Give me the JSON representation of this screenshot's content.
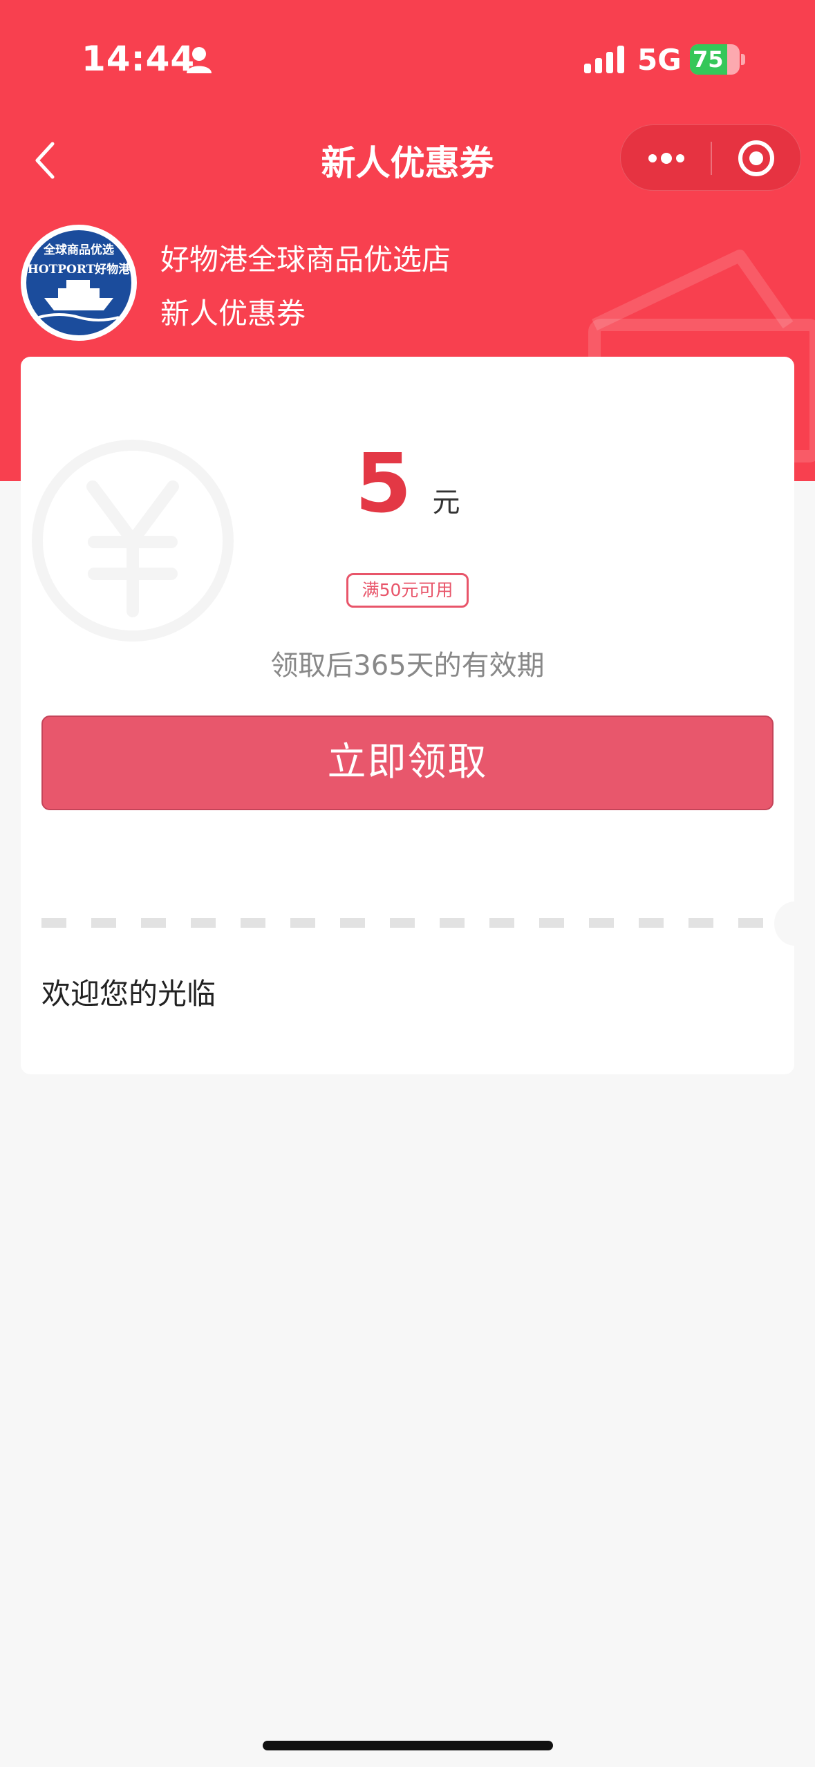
{
  "status_bar": {
    "time": "14:44",
    "network": "5G",
    "battery": "75",
    "battery_level": 0.75
  },
  "nav": {
    "title": "新人优惠券"
  },
  "shop": {
    "name": "好物港全球商品优选店",
    "subtitle": "新人优惠券",
    "logo_text_top": "全球商品优选",
    "logo_text_main": "HOTPORT好物港"
  },
  "coupon": {
    "amount": "5",
    "unit": "元",
    "condition": "满50元可用",
    "validity": "领取后365天的有效期",
    "claim_label": "立即领取",
    "welcome": "欢迎您的光临"
  },
  "colors": {
    "brand_red": "#f8404f",
    "amount_red": "#e33845",
    "button_pink": "#e8576c",
    "battery_green": "#35c759"
  },
  "icons": [
    "person-icon",
    "signal-icon",
    "battery-icon",
    "back-icon",
    "more-icon",
    "target-icon",
    "yen-icon",
    "ticket-icon"
  ]
}
